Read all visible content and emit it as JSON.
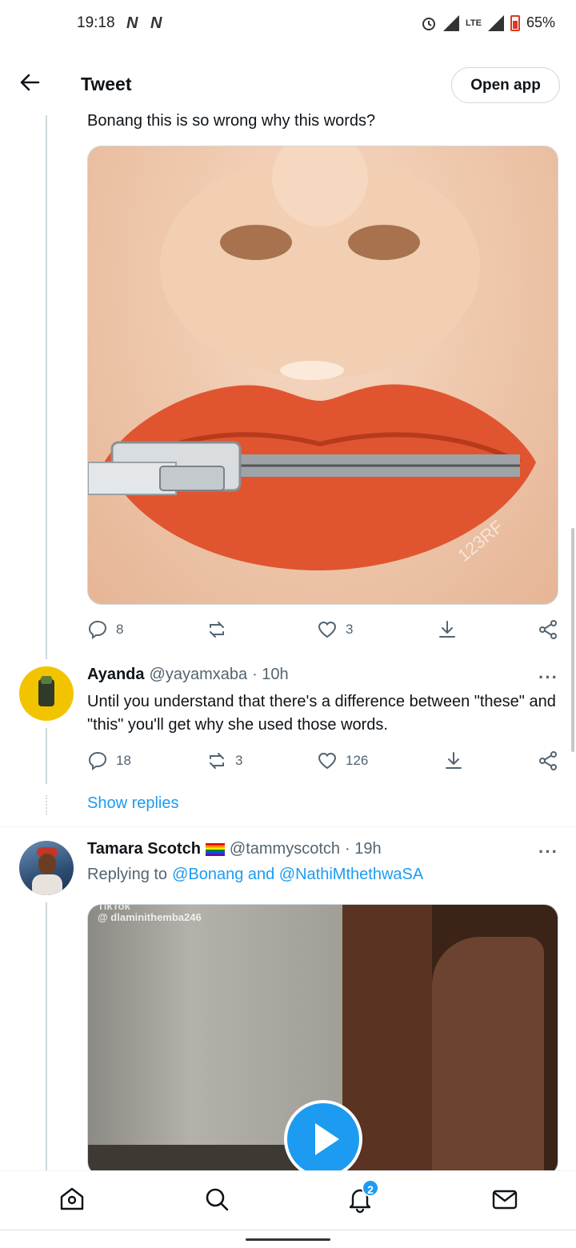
{
  "status_bar": {
    "time": "19:18",
    "notif_icons": [
      "N",
      "N"
    ],
    "battery": "65%",
    "network": "LTE"
  },
  "header": {
    "title": "Tweet",
    "open_app_label": "Open app"
  },
  "tweet1": {
    "text": "Bonang this is so wrong why this words?",
    "image_watermark": "123RF",
    "actions": {
      "replies": "8",
      "retweets": "",
      "likes": "3"
    }
  },
  "reply1": {
    "name": "Ayanda",
    "handle": "@yayamxaba",
    "time": "· 10h",
    "text": "Until you understand that there's a difference between \"these\" and \"this\" you'll get why she used those words.",
    "actions": {
      "replies": "18",
      "retweets": "3",
      "likes": "126"
    },
    "show_replies": "Show replies"
  },
  "reply2": {
    "name": "Tamara Scotch",
    "handle": "@tammyscotch",
    "time": "· 19h",
    "replying_prefix": "Replying to",
    "replying_to": "@Bonang and @NathiMthethwaSA",
    "video_watermark_app": "TikTok",
    "video_watermark_user": "@ dlaminithemba246"
  },
  "bottom_nav": {
    "items": [
      "home",
      "search",
      "notifications",
      "messages"
    ],
    "notif_count": "2"
  },
  "colors": {
    "accent": "#1d9bf0",
    "text": "#0f1419",
    "muted": "#536471",
    "border": "#cfd9de"
  }
}
